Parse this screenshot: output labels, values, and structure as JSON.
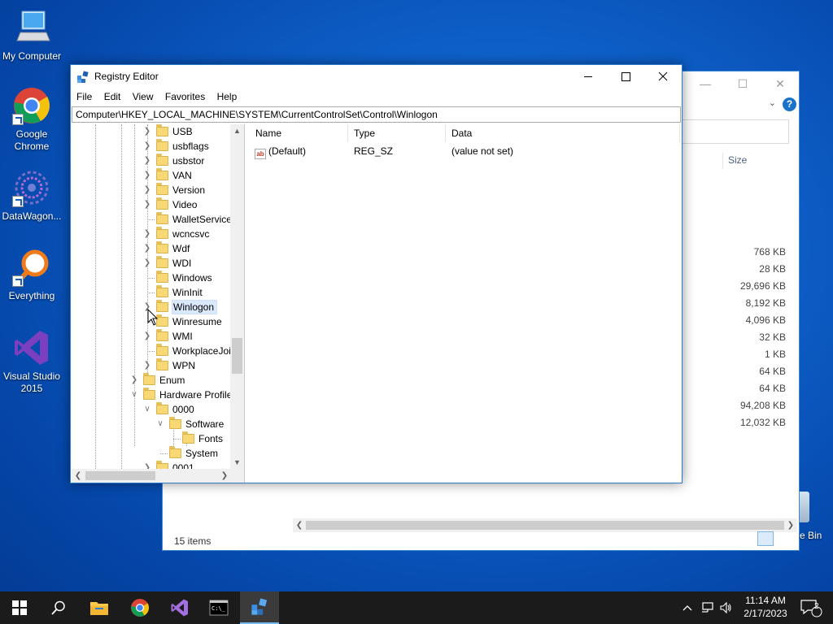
{
  "desktop": {
    "icons": [
      {
        "label": "My Computer"
      },
      {
        "label": "Google Chrome"
      },
      {
        "label": "DataWagon..."
      },
      {
        "label": "Everything"
      },
      {
        "label": "Visual Studio 2015"
      }
    ],
    "recycle_bin_label": "e Bin"
  },
  "explorer": {
    "size_header": "Size",
    "sizes": [
      "768 KB",
      "28 KB",
      "29,696 KB",
      "8,192 KB",
      "4,096 KB",
      "32 KB",
      "1 KB",
      "64 KB",
      "64 KB",
      "94,208 KB",
      "12,032 KB"
    ],
    "status": "15 items"
  },
  "regedit": {
    "title": "Registry Editor",
    "menu": [
      "File",
      "Edit",
      "View",
      "Favorites",
      "Help"
    ],
    "address": "Computer\\HKEY_LOCAL_MACHINE\\SYSTEM\\CurrentControlSet\\Control\\Winlogon",
    "tree": [
      {
        "label": "USB",
        "expandable": true
      },
      {
        "label": "usbflags",
        "expandable": true
      },
      {
        "label": "usbstor",
        "expandable": true
      },
      {
        "label": "VAN",
        "expandable": true
      },
      {
        "label": "Version",
        "expandable": true
      },
      {
        "label": "Video",
        "expandable": true
      },
      {
        "label": "WalletService",
        "expandable": false
      },
      {
        "label": "wcncsvc",
        "expandable": true
      },
      {
        "label": "Wdf",
        "expandable": true
      },
      {
        "label": "WDI",
        "expandable": true
      },
      {
        "label": "Windows",
        "expandable": false
      },
      {
        "label": "WinInit",
        "expandable": false
      },
      {
        "label": "Winlogon",
        "expandable": true,
        "selected": true
      },
      {
        "label": "Winresume",
        "expandable": false
      },
      {
        "label": "WMI",
        "expandable": true
      },
      {
        "label": "WorkplaceJoin",
        "expandable": false
      },
      {
        "label": "WPN",
        "expandable": true
      },
      {
        "label": "Enum",
        "expandable": true
      },
      {
        "label": "Hardware Profiles",
        "expandable": true,
        "expanded": true
      },
      {
        "label": "0000",
        "expandable": true,
        "expanded": true
      },
      {
        "label": "Software",
        "expandable": true,
        "expanded": true
      },
      {
        "label": "Fonts",
        "expandable": false
      },
      {
        "label": "System",
        "expandable": false
      },
      {
        "label": "0001",
        "expandable": true
      }
    ],
    "columns": [
      "Name",
      "Type",
      "Data"
    ],
    "values": [
      {
        "name": "(Default)",
        "type": "REG_SZ",
        "data": "(value not set)"
      }
    ]
  },
  "taskbar": {
    "time": "11:14 AM",
    "date": "2/17/2023",
    "notifications": "2",
    "accent": "#76b9ed"
  }
}
